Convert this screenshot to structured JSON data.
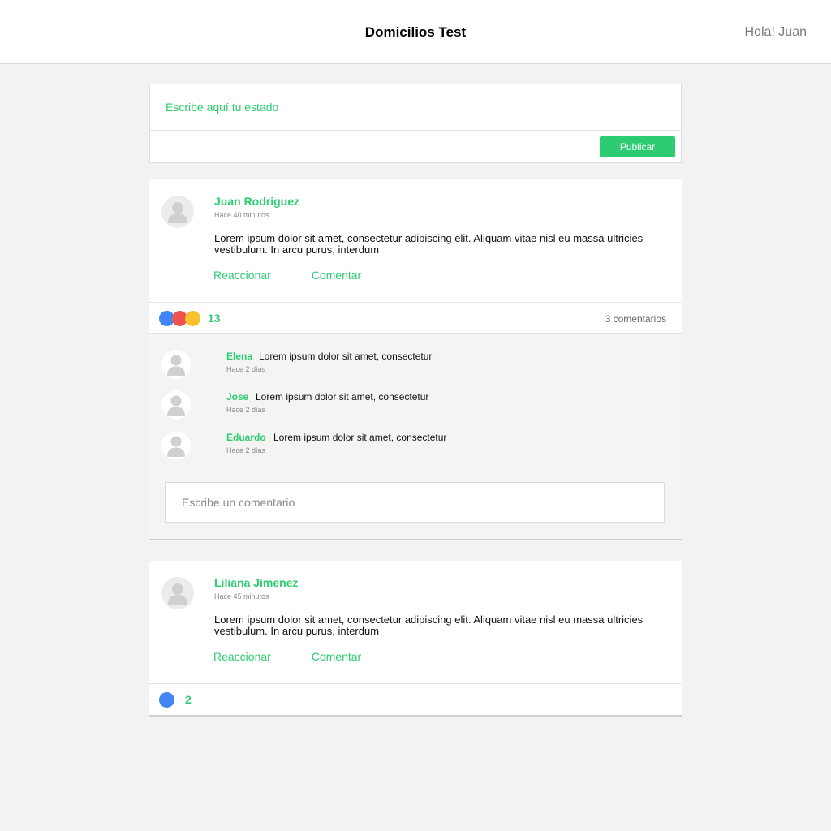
{
  "header": {
    "title": "Domicilios Test",
    "greeting": "Hola! Juan"
  },
  "composer": {
    "placeholder": "Escribe aquí tu estado",
    "publish_label": "Publicar"
  },
  "posts": [
    {
      "author": "Juan Rodriguez",
      "time": "Hace 40 minutos",
      "body": "Lorem ipsum dolor sit amet, consectetur adipiscing elit. Aliquam vitae nisl eu massa ultricies vestibulum. In arcu purus, interdum",
      "react_label": "Reaccionar",
      "comment_label": "Comentar",
      "reactions": [
        "#4285f4",
        "#ef5350",
        "#fbc02d"
      ],
      "reaction_count": "13",
      "comments_count_label": "3 comentarios",
      "comments": [
        {
          "author": "Elena",
          "text": "Lorem ipsum dolor sit amet, consectetur",
          "time": "Hace 2 días"
        },
        {
          "author": "Jose",
          "text": "Lorem ipsum dolor sit amet, consectetur",
          "time": "Hace 2 días"
        },
        {
          "author": "Eduardo",
          "text": "Lorem ipsum dolor sit amet, consectetur",
          "time": "Hace 2 días"
        }
      ],
      "comment_placeholder": "Escribe un comentario"
    },
    {
      "author": "Liliana Jimenez",
      "time": "Hace 45 minutos",
      "body": "Lorem ipsum dolor sit amet, consectetur adipiscing elit. Aliquam vitae nisl eu massa ultricies vestibulum. In arcu purus, interdum",
      "react_label": "Reaccionar",
      "comment_label": "Comentar",
      "reactions": [
        "#4285f4"
      ],
      "reaction_count": "2"
    }
  ],
  "colors": {
    "accent": "#2ecc71",
    "background": "#f2f2f2"
  }
}
